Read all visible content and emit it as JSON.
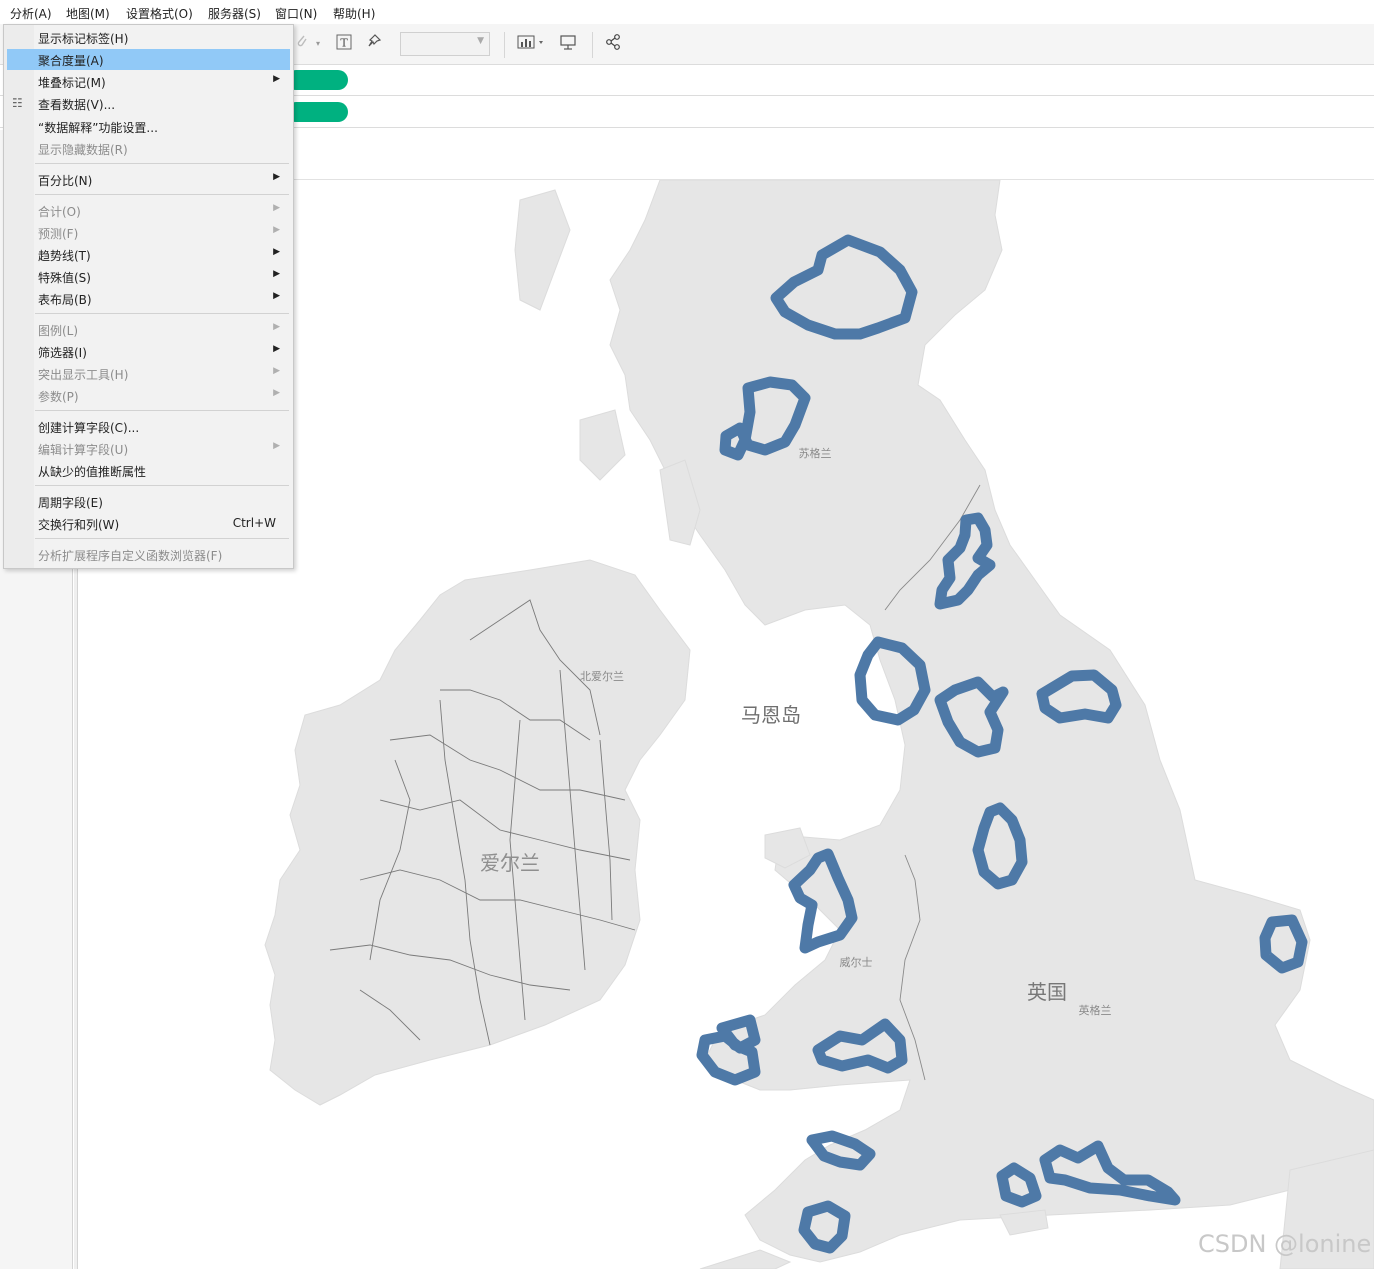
{
  "menubar": {
    "items": [
      {
        "label": "分析(A)",
        "name": "menu-analysis"
      },
      {
        "label": "地图(M)",
        "name": "menu-map"
      },
      {
        "label": "设置格式(O)",
        "name": "menu-format"
      },
      {
        "label": "服务器(S)",
        "name": "menu-server"
      },
      {
        "label": "窗口(N)",
        "name": "menu-window"
      },
      {
        "label": "帮助(H)",
        "name": "menu-help"
      }
    ]
  },
  "toolbar": {
    "icons": [
      "paperclip-icon",
      "text-label-icon",
      "pin-icon",
      "show-me-icon",
      "presentation-icon",
      "share-icon"
    ],
    "combo_value": ""
  },
  "shelves": {
    "pill_color": "#00b180"
  },
  "dropdown": {
    "items": [
      {
        "label": "显示标记标签(H)",
        "enabled": true
      },
      {
        "label": "聚合度量(A)",
        "enabled": true,
        "selected": true
      },
      {
        "label": "堆叠标记(M)",
        "enabled": true,
        "submenu": true
      },
      {
        "label": "查看数据(V)...",
        "enabled": true,
        "icon": "table-icon"
      },
      {
        "label": "“数据解释”功能设置...",
        "enabled": true
      },
      {
        "label": "显示隐藏数据(R)",
        "enabled": false
      },
      {
        "label": "百分比(N)",
        "enabled": true,
        "submenu": true
      },
      {
        "label": "合计(O)",
        "enabled": false,
        "submenu": true
      },
      {
        "label": "预测(F)",
        "enabled": false,
        "submenu": true
      },
      {
        "label": "趋势线(T)",
        "enabled": true,
        "submenu": true
      },
      {
        "label": "特殊值(S)",
        "enabled": true,
        "submenu": true
      },
      {
        "label": "表布局(B)",
        "enabled": true,
        "submenu": true
      },
      {
        "label": "图例(L)",
        "enabled": false,
        "submenu": true
      },
      {
        "label": "筛选器(I)",
        "enabled": true,
        "submenu": true
      },
      {
        "label": "突出显示工具(H)",
        "enabled": false,
        "submenu": true
      },
      {
        "label": "参数(P)",
        "enabled": false,
        "submenu": true
      },
      {
        "label": "创建计算字段(C)...",
        "enabled": true
      },
      {
        "label": "编辑计算字段(U)",
        "enabled": false,
        "submenu": true
      },
      {
        "label": "从缺少的值推断属性",
        "enabled": true
      },
      {
        "label": "周期字段(E)",
        "enabled": true
      },
      {
        "label": "交换行和列(W)",
        "enabled": true,
        "shortcut": "Ctrl+W"
      },
      {
        "label": "分析扩展程序自定义函数浏览器(F)",
        "enabled": false
      }
    ]
  },
  "map": {
    "labels": {
      "scotland": "苏格兰",
      "northern_ireland": "北爱尔兰",
      "isle_of_man": "马恩岛",
      "ireland": "爱尔兰",
      "wales": "威尔士",
      "uk": "英国",
      "england": "英格兰"
    },
    "land_color": "#e6e6e6",
    "border_color": "#7a7a7a",
    "mark_color": "#4e79a7"
  },
  "watermark": "CSDN @lonine"
}
